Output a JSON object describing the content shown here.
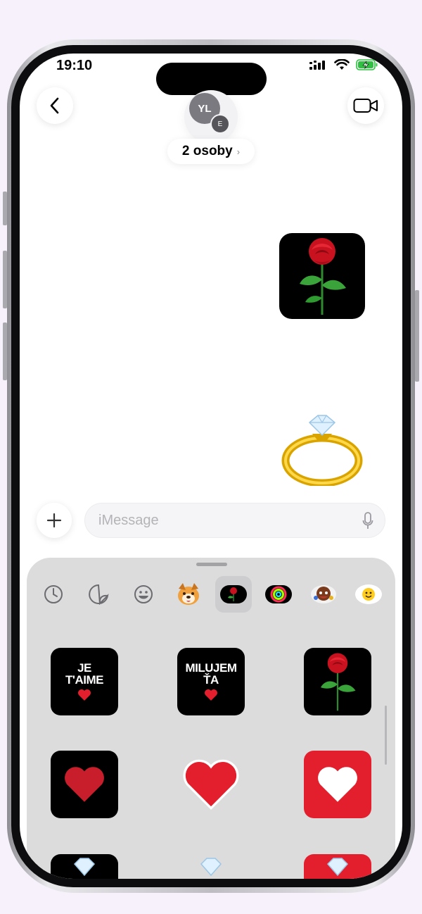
{
  "status_bar": {
    "time": "19:10"
  },
  "header": {
    "back_icon": "chevron-left-icon",
    "video_icon": "video-camera-icon",
    "avatars": [
      {
        "initials": "YL",
        "color": "#7a7a80"
      },
      {
        "initials": "E",
        "color": "#55555a"
      }
    ],
    "group_label": "2 osoby",
    "group_chevron": "›"
  },
  "messages": [
    {
      "type": "sticker",
      "content": "rose-sticker"
    },
    {
      "type": "sticker",
      "content": "diamond-ring-sticker"
    }
  ],
  "input": {
    "placeholder": "iMessage",
    "plus_icon": "plus-icon",
    "mic_icon": "microphone-icon"
  },
  "drawer": {
    "tabs": [
      {
        "name": "recents-icon",
        "selected": false
      },
      {
        "name": "sticker-icon",
        "selected": false
      },
      {
        "name": "emoji-icon",
        "selected": false
      },
      {
        "name": "memoji-dog-icon",
        "selected": false
      },
      {
        "name": "rose-pack-icon",
        "selected": true
      },
      {
        "name": "activity-rings-icon",
        "selected": false
      },
      {
        "name": "character-pack-icon",
        "selected": false
      },
      {
        "name": "smiley-pack-icon",
        "selected": false
      }
    ],
    "stickers": [
      {
        "name": "je-taime-sticker",
        "line1": "JE",
        "line2": "T'AIME"
      },
      {
        "name": "milujem-ta-sticker",
        "line1": "MILUJEM",
        "line2": "ŤA"
      },
      {
        "name": "rose-sticker"
      },
      {
        "name": "heart-black-tile-sticker"
      },
      {
        "name": "red-heart-sticker"
      },
      {
        "name": "white-heart-red-tile-sticker"
      },
      {
        "name": "ring-black-tile-sticker"
      },
      {
        "name": "ring-sticker"
      },
      {
        "name": "ring-red-tile-sticker"
      }
    ]
  },
  "colors": {
    "accent_red": "#e41f2d",
    "bubble_black": "#000000",
    "drawer_bg": "#dcdcdd",
    "battery_green": "#30c142"
  }
}
